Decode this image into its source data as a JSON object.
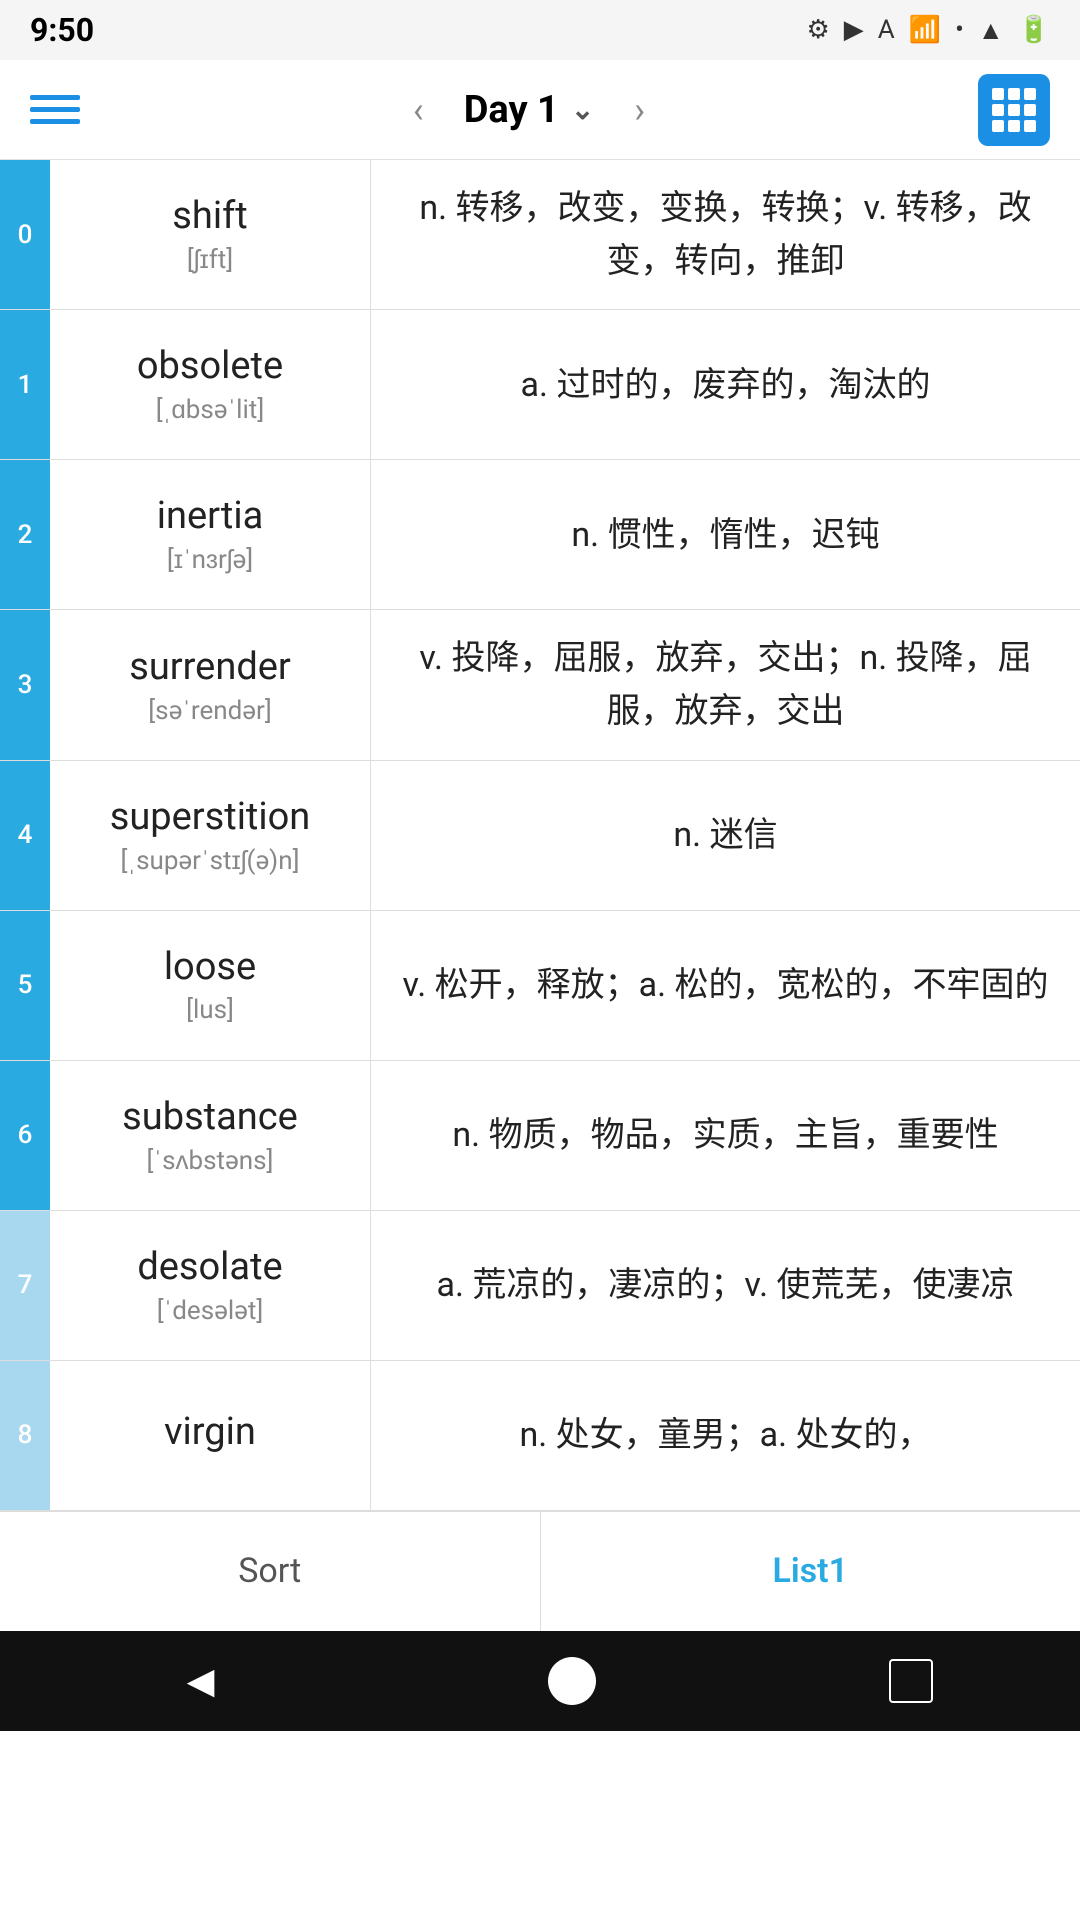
{
  "statusBar": {
    "time": "9:50",
    "icons": [
      "⚙",
      "▶",
      "A",
      "📶",
      "•",
      "📶",
      "🔋"
    ]
  },
  "header": {
    "menuLabel": "menu",
    "prevLabel": "‹",
    "title": "Day 1",
    "chevron": "∨",
    "nextLabel": "›",
    "gridLabel": "grid"
  },
  "words": [
    {
      "index": "0",
      "english": "shift",
      "phonetic": "[ʃɪft]",
      "definition": "n. 转移，改变，变换，转换；v. 转移，改变，转向，推卸",
      "indexLight": false
    },
    {
      "index": "1",
      "english": "obsolete",
      "phonetic": "[ˌɑbsəˈlit]",
      "definition": "a. 过时的，废弃的，淘汰的",
      "indexLight": false
    },
    {
      "index": "2",
      "english": "inertia",
      "phonetic": "[ɪˈnɜrʃə]",
      "definition": "n. 惯性，惰性，迟钝",
      "indexLight": false
    },
    {
      "index": "3",
      "english": "surrender",
      "phonetic": "[səˈrendər]",
      "definition": "v. 投降，屈服，放弃，交出；n. 投降，屈服，放弃，交出",
      "indexLight": false
    },
    {
      "index": "4",
      "english": "superstition",
      "phonetic": "[ˌsupərˈstɪʃ(ə)n]",
      "definition": "n. 迷信",
      "indexLight": false
    },
    {
      "index": "5",
      "english": "loose",
      "phonetic": "[lus]",
      "definition": "v. 松开，释放；a. 松的，宽松的，不牢固的",
      "indexLight": false
    },
    {
      "index": "6",
      "english": "substance",
      "phonetic": "[ˈsʌbstəns]",
      "definition": "n. 物质，物品，实质，主旨，重要性",
      "indexLight": false
    },
    {
      "index": "7",
      "english": "desolate",
      "phonetic": "[ˈdesələt]",
      "definition": "a. 荒凉的，凄凉的；v. 使荒芜，使凄凉",
      "indexLight": true
    },
    {
      "index": "8",
      "english": "virgin",
      "phonetic": "",
      "definition": "n. 处女，童男；a. 处女的，",
      "indexLight": true
    }
  ],
  "bottomTabs": [
    {
      "label": "Sort",
      "active": false
    },
    {
      "label": "List1",
      "active": true
    }
  ],
  "navBar": {
    "back": "◀",
    "home": "",
    "recent": ""
  }
}
